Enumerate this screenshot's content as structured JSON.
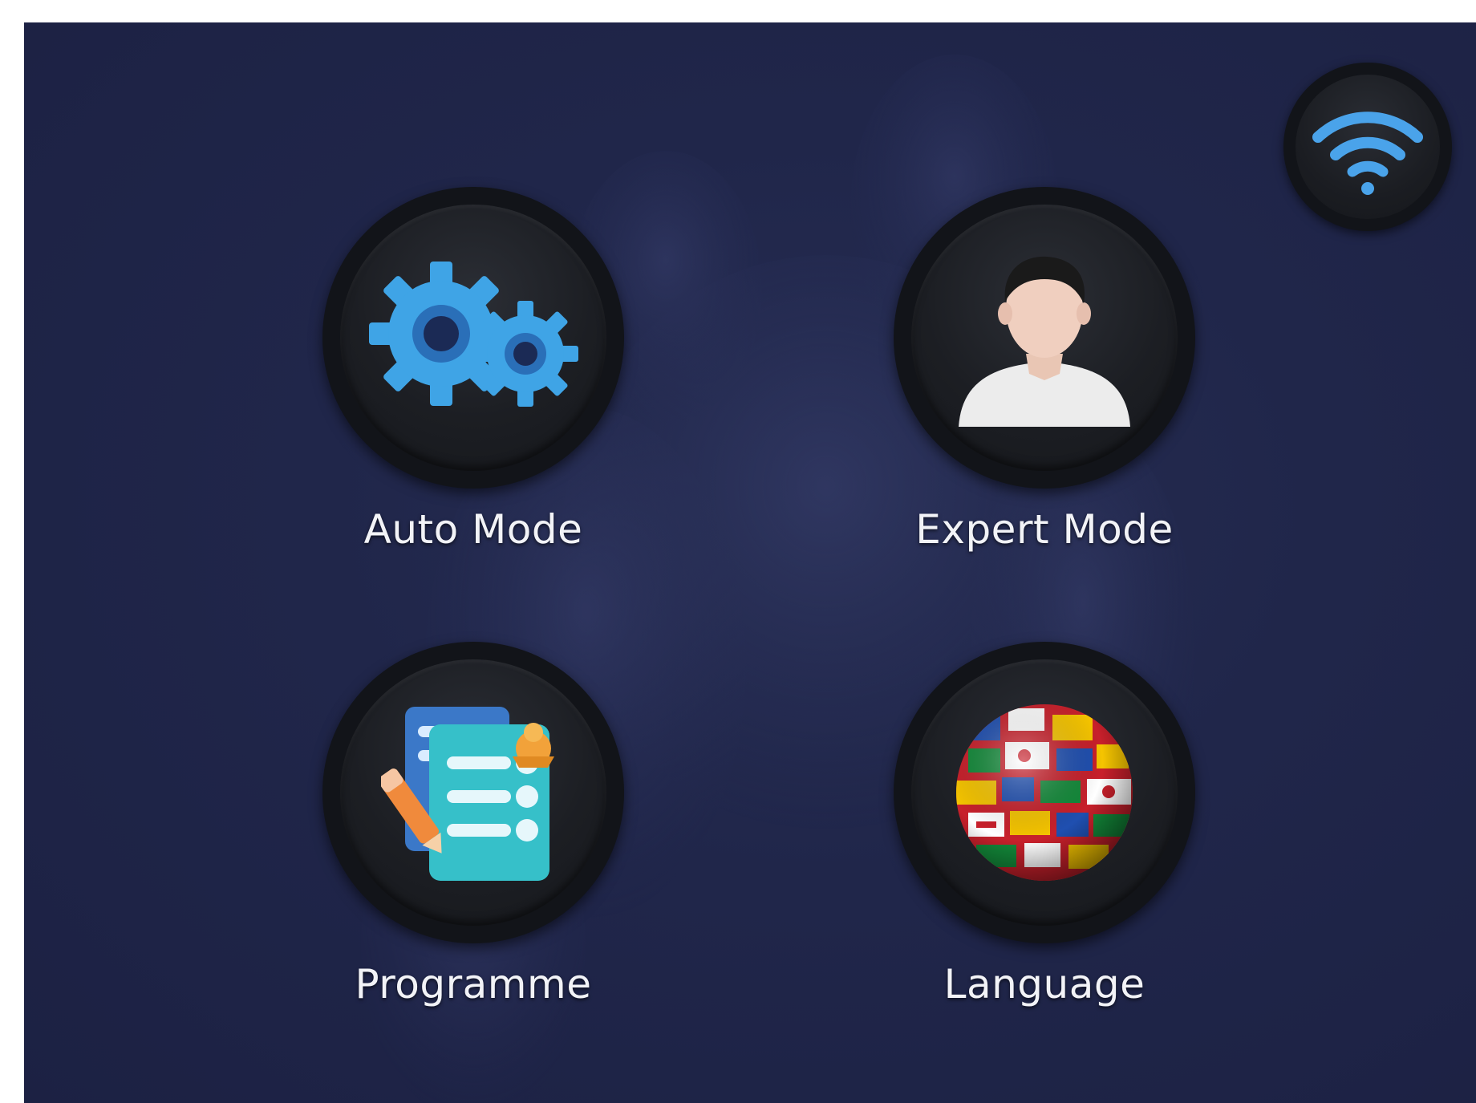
{
  "status": {
    "wifi_icon": "wifi-icon",
    "wifi_color": "#4aa3ea"
  },
  "menu": {
    "items": [
      {
        "label": "Auto Mode",
        "icon": "gears-icon"
      },
      {
        "label": "Expert Mode",
        "icon": "person-icon"
      },
      {
        "label": "Programme",
        "icon": "checklist-icon"
      },
      {
        "label": "Language",
        "icon": "globe-flags-icon"
      }
    ]
  },
  "colors": {
    "background": "#20264a",
    "button": "#121419",
    "label": "#f2f3f7",
    "gear_blue": "#3fa4e6"
  }
}
